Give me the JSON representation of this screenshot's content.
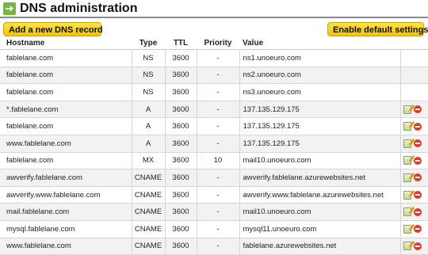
{
  "header": {
    "title": "DNS administration",
    "arrow_icon": "arrow-right-icon"
  },
  "toolbar": {
    "add_label": "Add a new DNS record",
    "default_label": "Enable default settings"
  },
  "table": {
    "columns": {
      "host": "Hostname",
      "type": "Type",
      "ttl": "TTL",
      "priority": "Priority",
      "value": "Value"
    },
    "rows": [
      {
        "host": "fablelane.com",
        "type": "NS",
        "ttl": "3600",
        "priority": "-",
        "value": "ns1.unoeuro.com"
      },
      {
        "host": "fablelane.com",
        "type": "NS",
        "ttl": "3600",
        "priority": "-",
        "value": "ns2.unoeuro.com"
      },
      {
        "host": "fablelane.com",
        "type": "NS",
        "ttl": "3600",
        "priority": "-",
        "value": "ns3.unoeuro.com"
      },
      {
        "host": "*.fablelane.com",
        "type": "A",
        "ttl": "3600",
        "priority": "-",
        "value": "137.135.129.175"
      },
      {
        "host": "fablelane.com",
        "type": "A",
        "ttl": "3600",
        "priority": "-",
        "value": "137.135.129.175"
      },
      {
        "host": "www.fablelane.com",
        "type": "A",
        "ttl": "3600",
        "priority": "-",
        "value": "137.135.129.175"
      },
      {
        "host": "fablelane.com",
        "type": "MX",
        "ttl": "3600",
        "priority": "10",
        "value": "mail10.unoeuro.com"
      },
      {
        "host": "awverify.fablelane.com",
        "type": "CNAME",
        "ttl": "3600",
        "priority": "-",
        "value": "awverify.fablelane.azurewebsites.net"
      },
      {
        "host": "awverify.www.fablelane.com",
        "type": "CNAME",
        "ttl": "3600",
        "priority": "-",
        "value": "awverify.www.fablelane.azurewebsites.net"
      },
      {
        "host": "mail.fablelane.com",
        "type": "CNAME",
        "ttl": "3600",
        "priority": "-",
        "value": "mail10.unoeuro.com"
      },
      {
        "host": "mysql.fablelane.com",
        "type": "CNAME",
        "ttl": "3600",
        "priority": "-",
        "value": "mysql11.unoeuro.com"
      },
      {
        "host": "www.fablelane.com",
        "type": "CNAME",
        "ttl": "3600",
        "priority": "-",
        "value": "fablelane.azurewebsites.net"
      }
    ]
  }
}
